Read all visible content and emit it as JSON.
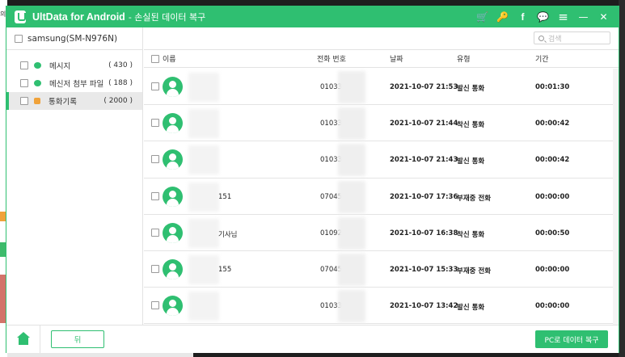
{
  "titlebar": {
    "app_name": "UltData for Android",
    "subtitle": "- 손실된 데이터 복구",
    "icons": [
      "cart-icon",
      "key-icon",
      "facebook-icon",
      "feedback-icon",
      "menu-icon",
      "minimize-icon",
      "close-icon"
    ],
    "glyphs": {
      "cart": "🛒",
      "key": "🔑",
      "facebook": "f",
      "feedback": "💬",
      "menu": "≡",
      "minimize": "—",
      "close": "✕"
    }
  },
  "sidebar": {
    "device": "samsung(SM-N976N)",
    "items": [
      {
        "label": "메시지",
        "count": "( 430 )",
        "icon": "message-icon",
        "selected": false
      },
      {
        "label": "메신저 첨부 파일",
        "count": "( 188 )",
        "icon": "attachment-icon",
        "selected": false
      },
      {
        "label": "통화기록",
        "count": "( 2000 )",
        "icon": "call-log-icon",
        "selected": true
      }
    ]
  },
  "search": {
    "placeholder": "검색"
  },
  "table": {
    "headers": {
      "name": "이름",
      "phone": "전화 번호",
      "date": "날짜",
      "type": "유형",
      "duration": "기간"
    },
    "rows": [
      {
        "name": "",
        "phone": "01033",
        "date": "2021-10-07 21:53",
        "type": "발신 통화",
        "duration": "00:01:30"
      },
      {
        "name": "",
        "phone": "01033",
        "date": "2021-10-07 21:44",
        "type": "착신 통화",
        "duration": "00:00:42"
      },
      {
        "name": "",
        "phone": "01033",
        "date": "2021-10-07 21:43",
        "type": "발신 통화",
        "duration": "00:00:42"
      },
      {
        "name": "151",
        "phone": "07045",
        "date": "2021-10-07 17:36",
        "type": "부재중 전화",
        "duration": "00:00:00"
      },
      {
        "name": "기사님",
        "phone": "01092",
        "date": "2021-10-07 16:38",
        "type": "착신 통화",
        "duration": "00:00:50"
      },
      {
        "name": "155",
        "phone": "07045",
        "date": "2021-10-07 15:33",
        "type": "부재중 전화",
        "duration": "00:00:00"
      },
      {
        "name": "",
        "phone": "01033",
        "date": "2021-10-07 13:42",
        "type": "발신 통화",
        "duration": "00:00:00"
      }
    ]
  },
  "footer": {
    "back_label": "뒤",
    "recover_label": "PC로 데이터 복구"
  },
  "colors": {
    "accent": "#2fbf71",
    "cart": "#ffd43b",
    "call_log_icon": "#f0a23a"
  }
}
